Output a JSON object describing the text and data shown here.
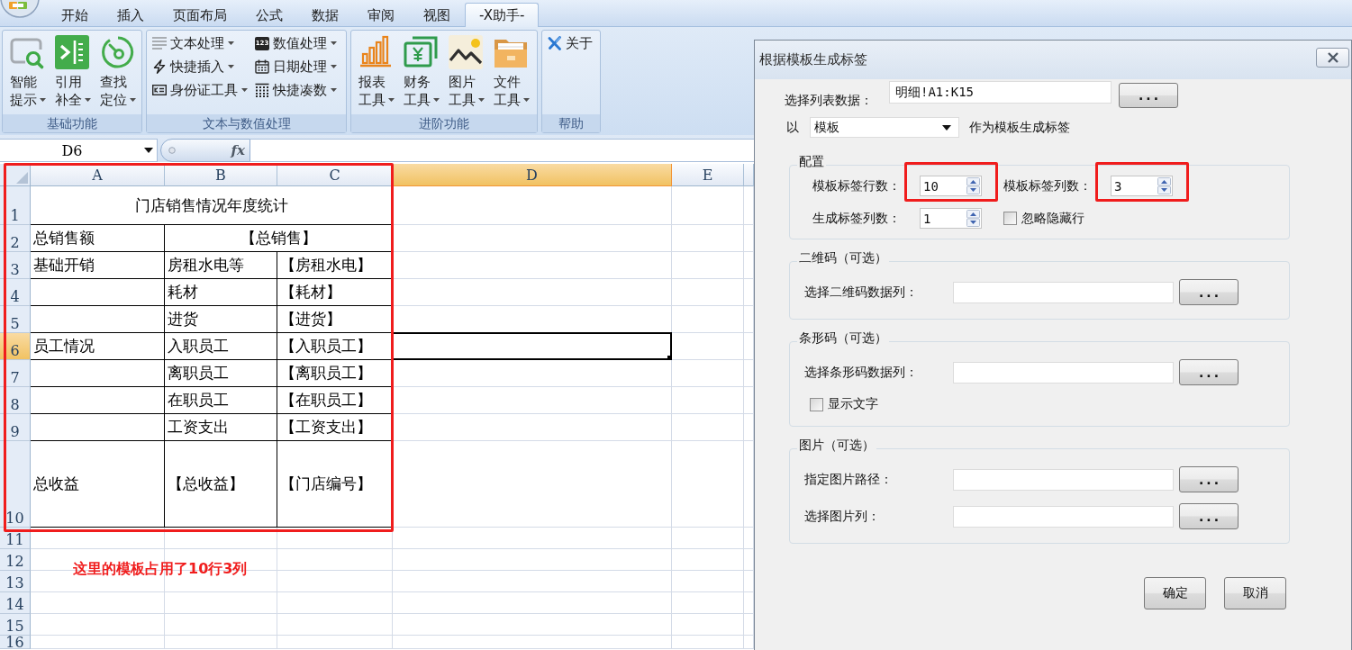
{
  "ribbon_tabs": [
    {
      "label": "开始",
      "selected": false
    },
    {
      "label": "插入",
      "selected": false
    },
    {
      "label": "页面布局",
      "selected": false
    },
    {
      "label": "公式",
      "selected": false
    },
    {
      "label": "数据",
      "selected": false
    },
    {
      "label": "审阅",
      "selected": false
    },
    {
      "label": "视图",
      "selected": false
    },
    {
      "label": "-X助手-",
      "selected": true
    }
  ],
  "ribbon_groups": [
    {
      "title": "基础功能",
      "kind": "large",
      "items": [
        {
          "label": "智能提示",
          "menu": true
        },
        {
          "label": "引用补全",
          "menu": true
        },
        {
          "label": "查找定位",
          "menu": true
        }
      ]
    },
    {
      "title": "文本与数值处理",
      "kind": "small",
      "items": [
        {
          "label": "文本处理",
          "menu": true
        },
        {
          "label": "数值处理",
          "menu": true,
          "icon_text": "123"
        },
        {
          "label": "快捷插入",
          "menu": true
        },
        {
          "label": "日期处理",
          "menu": true
        },
        {
          "label": "身份证工具",
          "menu": true
        },
        {
          "label": "快捷凑数",
          "menu": true
        }
      ]
    },
    {
      "title": "进阶功能",
      "kind": "large",
      "items": [
        {
          "label": "报表工具",
          "menu": true
        },
        {
          "label": "财务工具",
          "menu": true
        },
        {
          "label": "图片工具",
          "menu": true
        },
        {
          "label": "文件工具",
          "menu": true
        }
      ]
    },
    {
      "title": "帮助",
      "kind": "small",
      "items": [
        {
          "label": "关于",
          "menu": false
        }
      ]
    }
  ],
  "formula_bar": {
    "name_box": "D6",
    "function_label": "fx"
  },
  "sheet": {
    "columns": [
      {
        "label": "A",
        "selected": false
      },
      {
        "label": "B",
        "selected": false
      },
      {
        "label": "C",
        "selected": false
      },
      {
        "label": "D",
        "selected": true
      },
      {
        "label": "E",
        "selected": false
      }
    ],
    "rows": [
      {
        "header": "1",
        "selected": false,
        "merged": true,
        "cells": [
          "门店销售情况年度统计"
        ]
      },
      {
        "header": "2",
        "selected": false,
        "merged": true,
        "cells": [
          "总销售额",
          "【总销售】"
        ]
      },
      {
        "header": "3",
        "selected": false,
        "merged": false,
        "cells": [
          "基础开销",
          "房租水电等",
          "【房租水电】"
        ]
      },
      {
        "header": "4",
        "selected": false,
        "merged": false,
        "cells": [
          null,
          "耗材",
          "【耗材】"
        ]
      },
      {
        "header": "5",
        "selected": false,
        "merged": false,
        "cells": [
          null,
          "进货",
          "【进货】"
        ]
      },
      {
        "header": "6",
        "selected": true,
        "merged": false,
        "cells": [
          "员工情况",
          "入职员工",
          "【入职员工】"
        ]
      },
      {
        "header": "7",
        "selected": false,
        "merged": false,
        "cells": [
          null,
          "离职员工",
          "【离职员工】"
        ]
      },
      {
        "header": "8",
        "selected": false,
        "merged": false,
        "cells": [
          null,
          "在职员工",
          "【在职员工】"
        ]
      },
      {
        "header": "9",
        "selected": false,
        "merged": false,
        "cells": [
          null,
          "工资支出",
          "【工资支出】"
        ]
      },
      {
        "header": "10",
        "selected": false,
        "merged": false,
        "cells": [
          "总收益",
          "【总收益】",
          "【门店编号】"
        ]
      },
      {
        "header": "11",
        "selected": false
      },
      {
        "header": "12",
        "selected": false
      },
      {
        "header": "13",
        "selected": false
      },
      {
        "header": "14",
        "selected": false
      },
      {
        "header": "15",
        "selected": false
      },
      {
        "header": "16",
        "selected": false
      }
    ],
    "annotation": {
      "text": "这里的模板占用了10行3列",
      "framed": true
    }
  },
  "dialog": {
    "title": "根据模板生成标签",
    "source": {
      "label": "选择列表数据：",
      "value": "明细!A1:K15",
      "button": "..."
    },
    "mode": {
      "prefix": "以",
      "value": "模板",
      "suffix": "作为模板生成标签"
    },
    "groups": [
      {
        "title": "配置",
        "items": [
          {
            "kind": "spinner",
            "label": "模板标签行数：",
            "value": "10",
            "highlighted": true
          },
          {
            "kind": "spinner",
            "label": "模板标签列数：",
            "value": "3",
            "highlighted": true
          },
          {
            "kind": "spinner",
            "label": "生成标签列数：",
            "value": "1",
            "highlighted": false
          },
          {
            "kind": "checkbox",
            "label": "忽略隐藏行",
            "checked": false
          }
        ]
      },
      {
        "title": "二维码（可选）",
        "items": [
          {
            "kind": "picker",
            "label": "选择二维码数据列：",
            "button": "..."
          }
        ]
      },
      {
        "title": "条形码（可选）",
        "items": [
          {
            "kind": "picker",
            "label": "选择条形码数据列：",
            "button": "..."
          },
          {
            "kind": "checkbox",
            "label": "显示文字",
            "checked": false
          }
        ]
      },
      {
        "title": "图片（可选）",
        "items": [
          {
            "kind": "picker",
            "label": "指定图片路径：",
            "button": "..."
          },
          {
            "kind": "picker",
            "label": "选择图片列：",
            "button": "..."
          }
        ]
      }
    ],
    "buttons": [
      "确定",
      "取消"
    ]
  }
}
